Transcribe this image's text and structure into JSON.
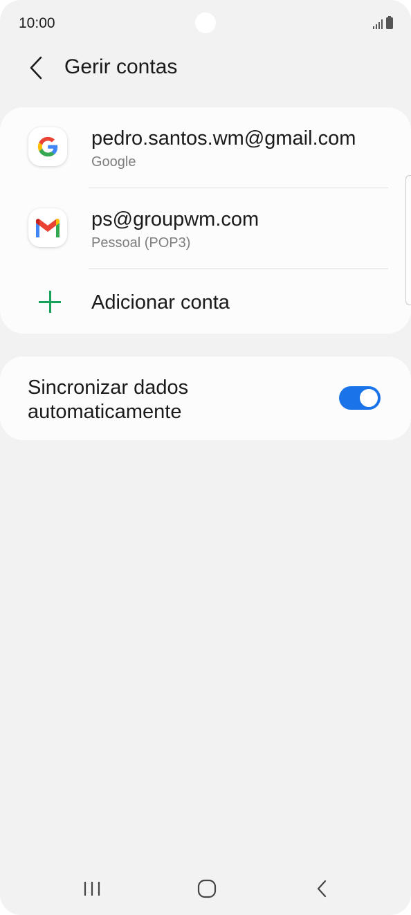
{
  "status_bar": {
    "time": "10:00",
    "icons": [
      "signal-icon",
      "battery-icon"
    ]
  },
  "header": {
    "back_icon": "chevron-left-icon",
    "title": "Gerir contas"
  },
  "accounts": [
    {
      "email": "pedro.santos.wm@gmail.com",
      "type": "Google",
      "icon": "google-icon"
    },
    {
      "email": "ps@groupwm.com",
      "type": "Pessoal (POP3)",
      "icon": "gmail-icon"
    }
  ],
  "add_account": {
    "label": "Adicionar conta",
    "icon": "plus-icon"
  },
  "sync": {
    "label": "Sincronizar dados automaticamente",
    "enabled": true
  },
  "nav": {
    "recent_icon": "recent-apps-icon",
    "home_icon": "home-icon",
    "back_icon": "back-icon"
  },
  "colors": {
    "accent": "#1a73e8",
    "add_green": "#19a35a",
    "background": "#f2f2f2",
    "card": "#fcfcfc",
    "secondary_text": "#7d7d7d"
  }
}
